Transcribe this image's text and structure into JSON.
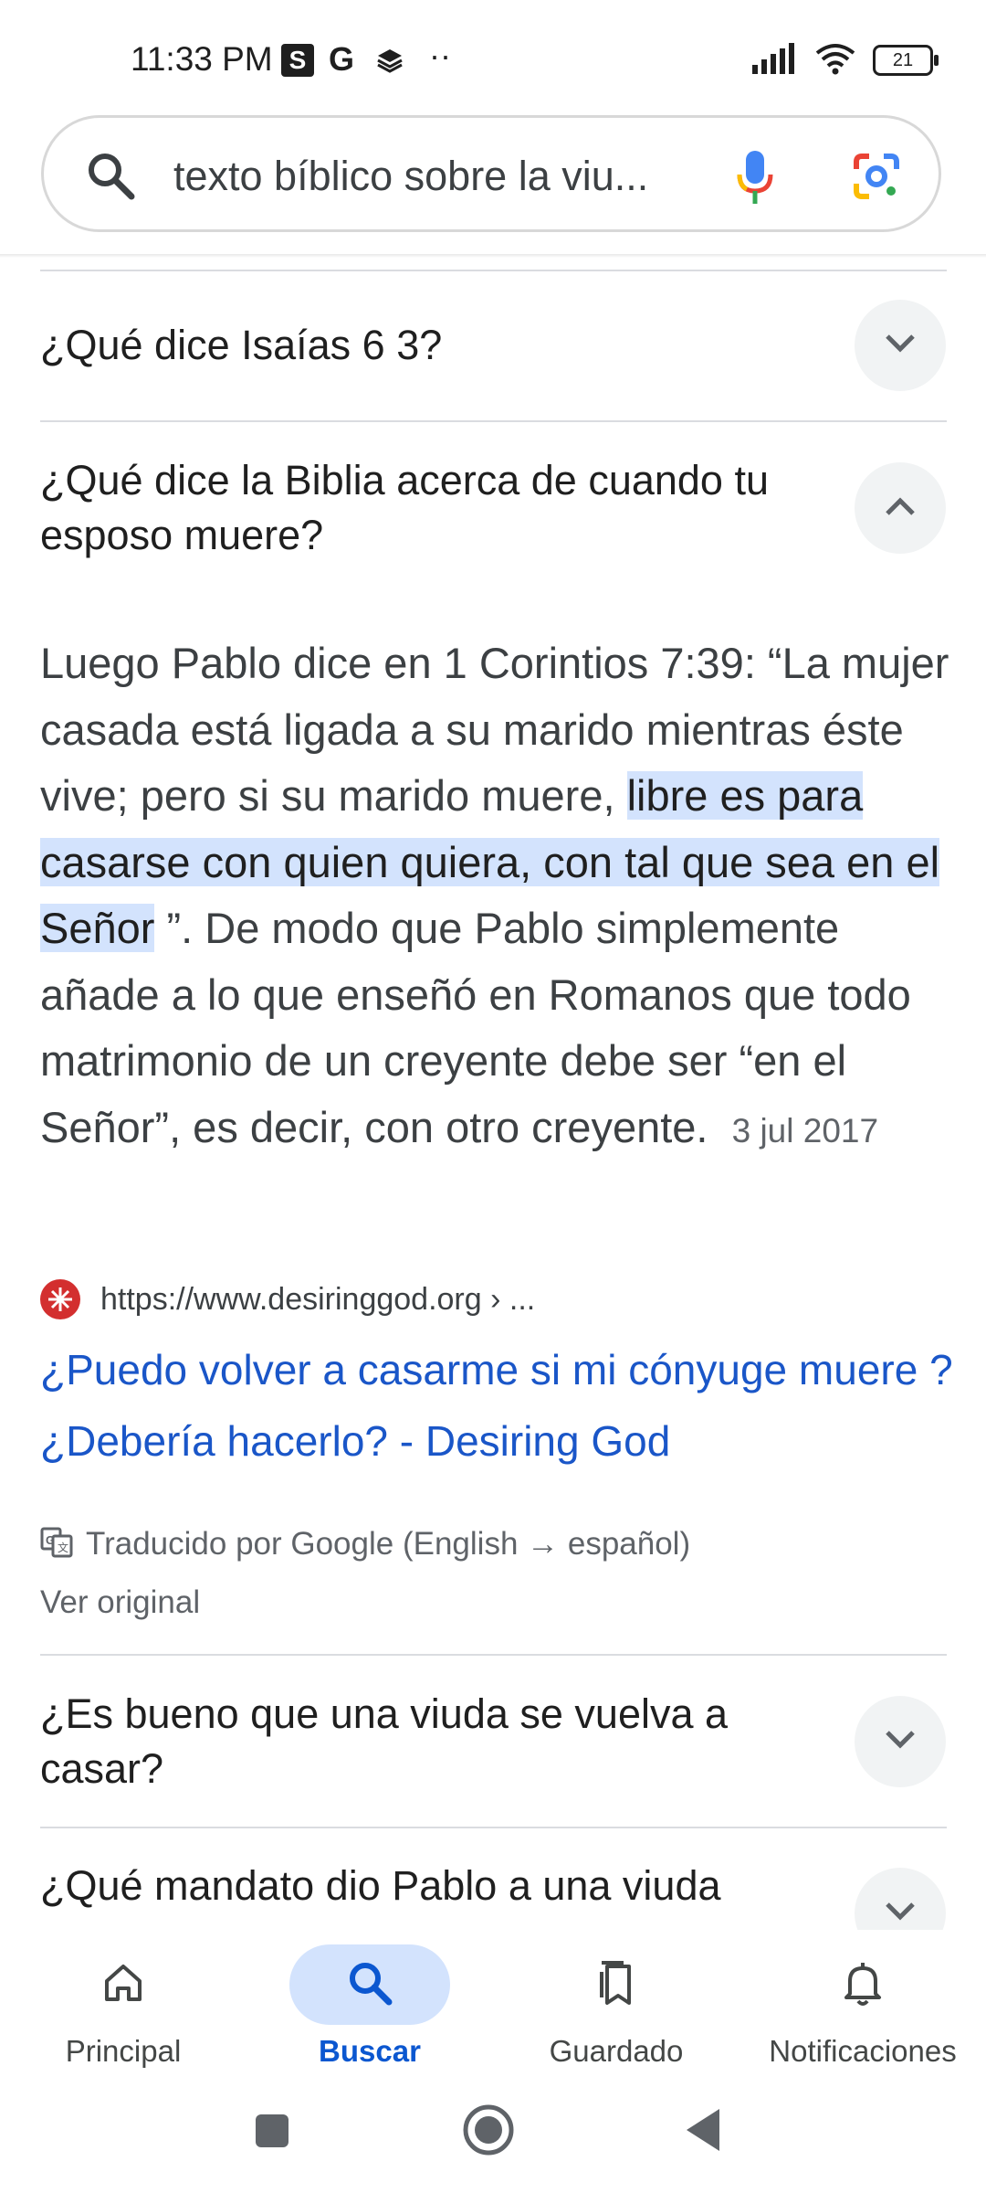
{
  "status_bar": {
    "time": "11:33 PM",
    "app_icon_s": "S",
    "app_icon_g": "G",
    "more_indicator": "··",
    "battery": "21"
  },
  "search": {
    "query": "texto bíblico sobre la viu..."
  },
  "faq": [
    {
      "question": "¿Qué dice Isaías 6 3?",
      "expanded": false
    },
    {
      "question": "¿Qué dice la Biblia acerca de cuando tu esposo muere?",
      "expanded": true
    },
    {
      "question": "¿Es bueno que una viuda se vuelva a casar?",
      "expanded": false
    },
    {
      "question": "¿Qué mandato dio Pablo a una viuda",
      "expanded": false
    }
  ],
  "answer": {
    "text_before": "Luego Pablo dice en 1 Corintios 7:39: “La mujer casada está ligada a su marido mientras éste vive; pero si su marido muere, ",
    "highlight": "libre es para casarse con quien quiera, con tal que sea en el Señor",
    "text_after": " ”. De modo que Pablo simplemente añade a lo que enseñó en Romanos que todo matrimonio de un creyente debe ser “en el Señor”, es decir, con otro creyente.",
    "date": "3 jul 2017"
  },
  "source": {
    "url": "https://www.desiringgod.org › ...",
    "title": "¿Puedo volver a casarme si mi cónyuge muere ? ¿Debería hacerlo? - Desiring God",
    "translated_by": "Traducido por Google (English → español)",
    "see_original": "Ver original"
  },
  "bottom_nav": [
    {
      "label": "Principal",
      "icon": "home-icon",
      "active": false
    },
    {
      "label": "Buscar",
      "icon": "search-icon",
      "active": true
    },
    {
      "label": "Guardado",
      "icon": "bookmarks-icon",
      "active": false
    },
    {
      "label": "Notificaciones",
      "icon": "bell-icon",
      "active": false
    }
  ],
  "colors": {
    "link": "#1a56c8",
    "highlight": "#d3e3fd",
    "active_nav": "#0b57d0",
    "favicon": "#d32f2f"
  }
}
